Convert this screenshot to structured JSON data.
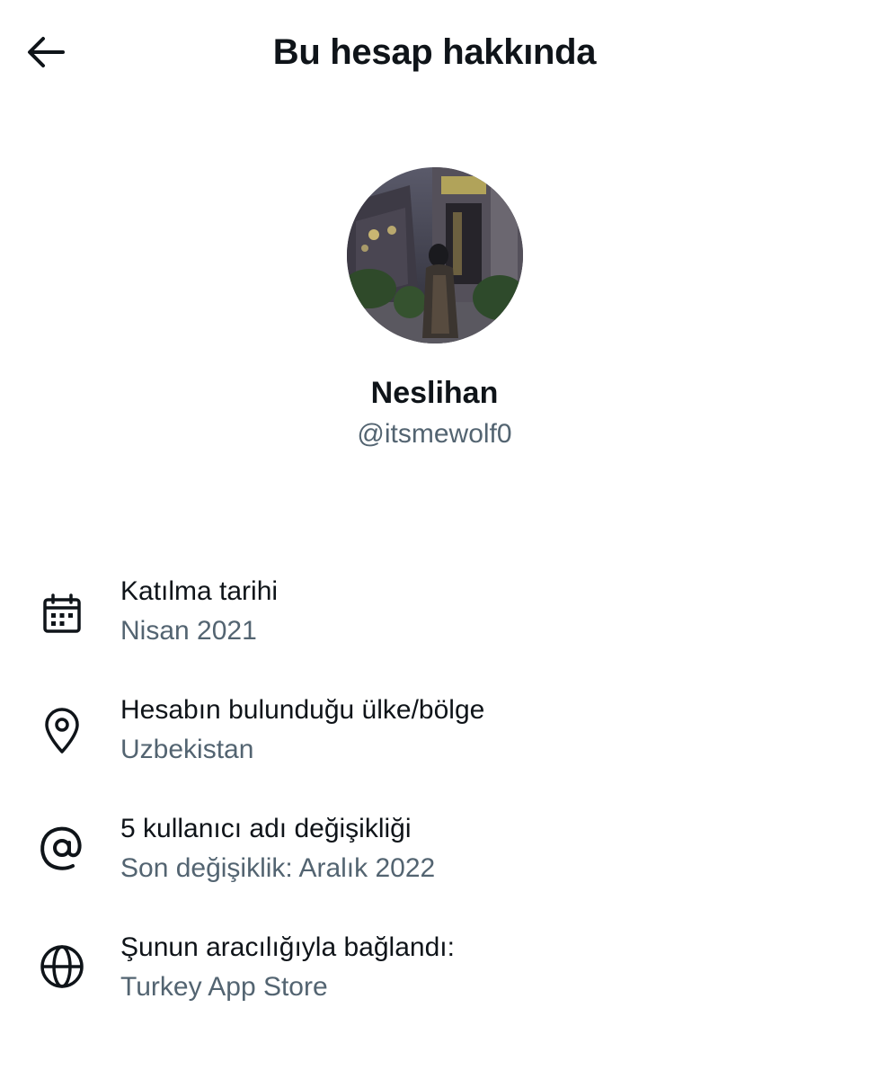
{
  "header": {
    "title": "Bu hesap hakkında",
    "back_icon": "arrow-left-icon"
  },
  "profile": {
    "display_name": "Neslihan",
    "handle": "@itsmewolf0"
  },
  "details": [
    {
      "icon": "calendar-icon",
      "title": "Katılma tarihi",
      "value": "Nisan 2021"
    },
    {
      "icon": "location-pin-icon",
      "title": "Hesabın bulunduğu ülke/bölge",
      "value": "Uzbekistan"
    },
    {
      "icon": "at-sign-icon",
      "title": "5 kullanıcı adı değişikliği",
      "value": "Son değişiklik: Aralık 2022"
    },
    {
      "icon": "globe-icon",
      "title": "Şunun aracılığıyla bağlandı:",
      "value": "Turkey App Store"
    }
  ],
  "colors": {
    "text_primary": "#0f1419",
    "text_secondary": "#536471",
    "background": "#ffffff"
  }
}
